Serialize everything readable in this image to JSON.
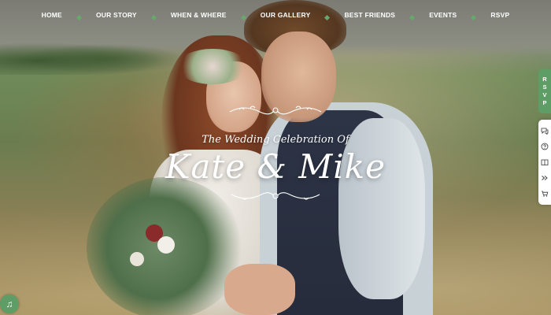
{
  "nav": {
    "items": [
      {
        "label": "HOME"
      },
      {
        "label": "OUR STORY"
      },
      {
        "label": "WHEN & WHERE"
      },
      {
        "label": "OUR GALLERY"
      },
      {
        "label": "BEST FRIENDS"
      },
      {
        "label": "EVENTS"
      },
      {
        "label": "RSVP"
      }
    ],
    "separator_color": "#66a86c"
  },
  "hero": {
    "subtitle": "The Wedding Celebration Of",
    "names": "Kate & Mike"
  },
  "side_panel": {
    "rsvp_letters": [
      "R",
      "S",
      "V",
      "P"
    ],
    "accent_color": "#5f9d66",
    "tools": [
      "chat-icon",
      "help-icon",
      "book-icon",
      "forward-icon",
      "cart-icon"
    ]
  },
  "music_button": {
    "icon": "music-note-icon",
    "glyph": "♫"
  }
}
